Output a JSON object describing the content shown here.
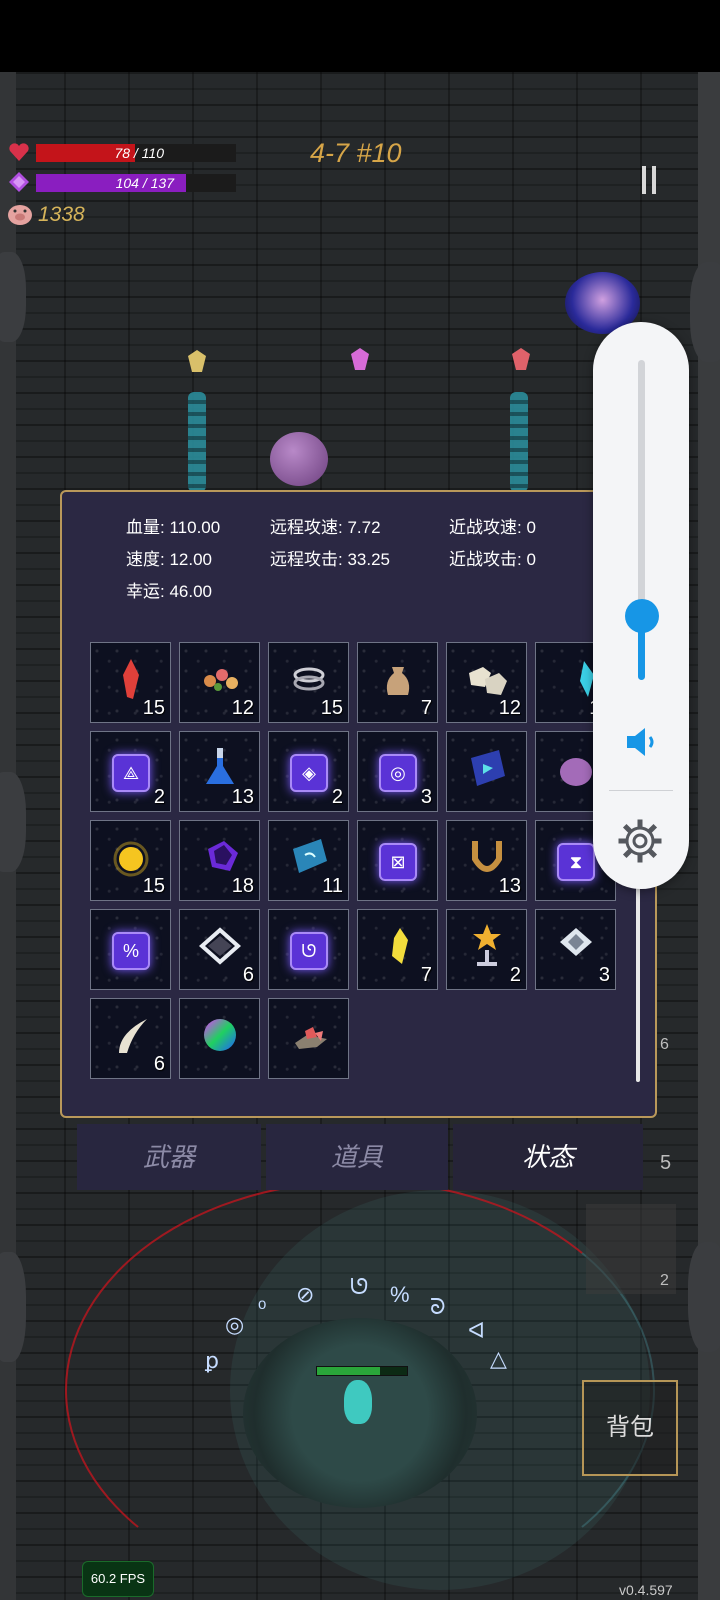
{
  "hud": {
    "hp_text": "78 / 110",
    "hp_fraction": 0.709,
    "mp_text": "104 / 137",
    "mp_fraction": 0.759,
    "coins": "1338",
    "level": "4-7 #10"
  },
  "stats": {
    "hp_label": "血量:",
    "hp_value": "110.00",
    "ranged_speed_label": "远程攻速:",
    "ranged_speed_value": "7.72",
    "melee_speed_label": "近战攻速:",
    "melee_speed_value": "0",
    "speed_label": "速度:",
    "speed_value": "12.00",
    "ranged_attack_label": "远程攻击:",
    "ranged_attack_value": "33.25",
    "melee_attack_label": "近战攻击:",
    "melee_attack_value": "0",
    "luck_label": "幸运:",
    "luck_value": "46.00"
  },
  "items": [
    {
      "icon": "red-crystal-icon",
      "count": "15"
    },
    {
      "icon": "flower-cluster-icon",
      "count": "12"
    },
    {
      "icon": "silver-rings-icon",
      "count": "15"
    },
    {
      "icon": "sack-icon",
      "count": "7"
    },
    {
      "icon": "rock-cubes-icon",
      "count": "12"
    },
    {
      "icon": "cyan-crystal-icon",
      "count": "11"
    },
    {
      "icon": "rune-triangle-icon",
      "count": "2"
    },
    {
      "icon": "blue-potion-icon",
      "count": "13"
    },
    {
      "icon": "rune-eye-icon",
      "count": "2"
    },
    {
      "icon": "rune-spiral-icon",
      "count": "3"
    },
    {
      "icon": "spellbook-icon",
      "count": ""
    },
    {
      "icon": "purple-slime-icon",
      "count": "3"
    },
    {
      "icon": "gold-orb-icon",
      "count": "15"
    },
    {
      "icon": "purple-gem-icon",
      "count": "18"
    },
    {
      "icon": "blue-tome-icon",
      "count": "11"
    },
    {
      "icon": "rune-x-icon",
      "count": ""
    },
    {
      "icon": "horseshoe-icon",
      "count": "13"
    },
    {
      "icon": "rune-hourglass-icon",
      "count": ""
    },
    {
      "icon": "rune-percent-icon",
      "count": ""
    },
    {
      "icon": "diamond-frame-icon",
      "count": "6"
    },
    {
      "icon": "rune-hook-icon",
      "count": ""
    },
    {
      "icon": "yellow-crystal-icon",
      "count": "7"
    },
    {
      "icon": "star-trophy-icon",
      "count": "2"
    },
    {
      "icon": "crystal-cluster-icon",
      "count": "3"
    },
    {
      "icon": "horn-icon",
      "count": "6"
    },
    {
      "icon": "rainbow-orb-icon",
      "count": ""
    },
    {
      "icon": "red-shards-icon",
      "count": ""
    }
  ],
  "tabs": {
    "weapons": "武器",
    "items": "道具",
    "status": "状态"
  },
  "volume": {
    "level_fraction": 0.2
  },
  "bottom": {
    "bag": "背包",
    "fps": "60.2 FPS",
    "version": "v0.4.597",
    "side_count_1": "5",
    "side_count_2": "2",
    "side_count_3": "6"
  },
  "colors": {
    "hp": "#c4141a",
    "mp": "#8a1ec0",
    "gold": "#d6a548",
    "panel": "#2b2843",
    "panel_border": "#b9985a",
    "volume_accent": "#1796e6"
  }
}
